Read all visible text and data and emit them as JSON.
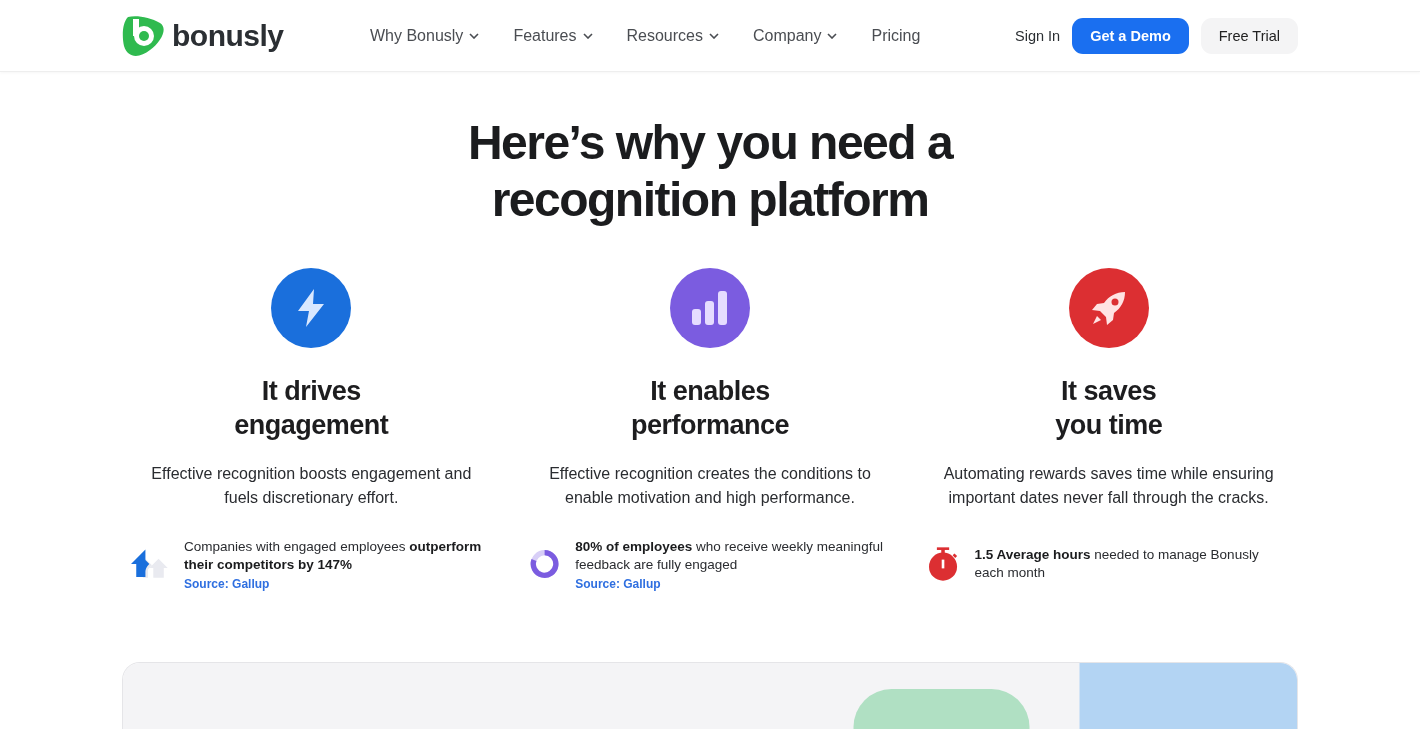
{
  "header": {
    "logo": "bonusly",
    "nav": [
      {
        "label": "Why Bonusly",
        "dropdown": true
      },
      {
        "label": "Features",
        "dropdown": true
      },
      {
        "label": "Resources",
        "dropdown": true
      },
      {
        "label": "Company",
        "dropdown": true
      },
      {
        "label": "Pricing",
        "dropdown": false
      }
    ],
    "sign_in": "Sign In",
    "demo_button": "Get a Demo",
    "trial_button": "Free Trial"
  },
  "heading": [
    "Here’s why you need a",
    "recognition platform"
  ],
  "features": [
    {
      "kind": "bolt",
      "color": "#1a6fdc",
      "title": [
        "It drives",
        "engagement"
      ],
      "text": "Effective recognition boosts engagement and fuels discretionary effort.",
      "stat": {
        "kind": "arrows",
        "text": "Companies with engaged employees **outperform their competitors by 147%**",
        "source": "Source: Gallup"
      }
    },
    {
      "kind": "bars",
      "color": "#7b5ce0",
      "title": [
        "It enables",
        "performance"
      ],
      "text": "Effective recognition creates the conditions to enable motivation and high performance.",
      "stat": {
        "kind": "donut",
        "text": "**80% of employees** who receive weekly meaningful feedback are fully engaged",
        "source": "Source: Gallup"
      }
    },
    {
      "kind": "rocket",
      "color": "#dc2f32",
      "title": [
        "It saves",
        "you time"
      ],
      "text": "Automating rewards saves time while ensuring important dates never fall through the cracks.",
      "stat": {
        "kind": "stopwatch",
        "text": "**1.5 Average hours** needed to manage Bonusly each month"
      }
    }
  ],
  "showcase": {
    "kind": "picture"
  }
}
